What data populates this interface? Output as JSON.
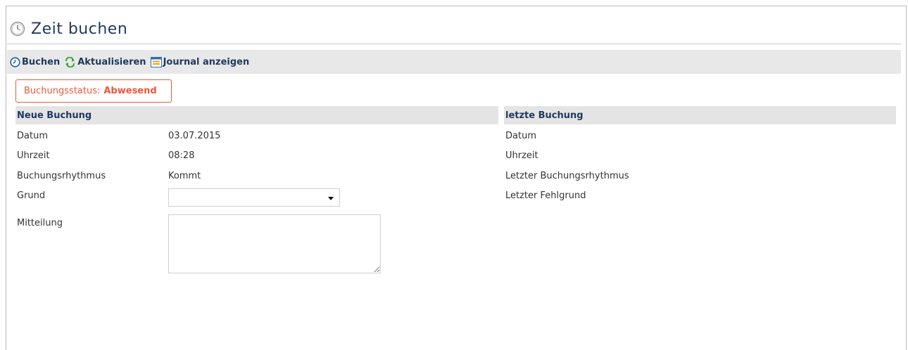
{
  "page": {
    "title": "Zeit buchen"
  },
  "toolbar": {
    "buchen": "Buchen",
    "aktualisieren": "Aktualisieren",
    "journal": "Journal anzeigen"
  },
  "status": {
    "label": "Buchungsstatus:",
    "value": "Abwesend",
    "color": "#e8593c"
  },
  "neue_buchung": {
    "header": "Neue Buchung",
    "datum_label": "Datum",
    "datum_value": "03.07.2015",
    "uhrzeit_label": "Uhrzeit",
    "uhrzeit_value": "08:28",
    "rhythmus_label": "Buchungsrhythmus",
    "rhythmus_value": "Kommt",
    "grund_label": "Grund",
    "grund_value": "",
    "mitteilung_label": "Mitteilung",
    "mitteilung_value": ""
  },
  "letzte_buchung": {
    "header": "letzte Buchung",
    "datum_label": "Datum",
    "uhrzeit_label": "Uhrzeit",
    "rhythmus_label": "Letzter Buchungsrhythmus",
    "fehlgrund_label": "Letzter Fehlgrund"
  },
  "icons": {
    "title": "clock-icon",
    "buchen": "clock-arrow-icon",
    "aktualisieren": "refresh-icon",
    "journal": "list-icon"
  }
}
